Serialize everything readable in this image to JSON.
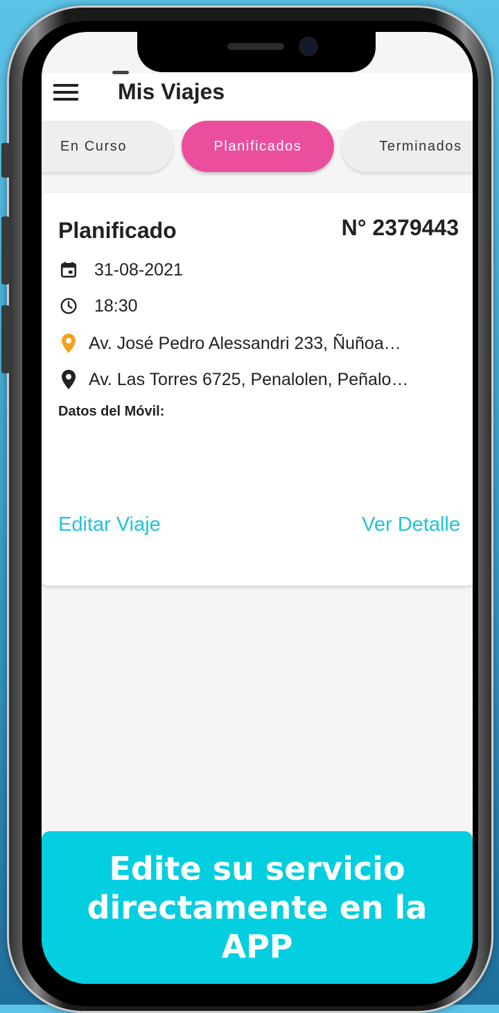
{
  "app": {
    "title": "Mis Viajes"
  },
  "tabs": [
    {
      "label": "En Curso",
      "active": false
    },
    {
      "label": "Planificados",
      "active": true
    },
    {
      "label": "Terminados",
      "active": false
    }
  ],
  "trip_card": {
    "status": "Planificado",
    "number": "N° 2379443",
    "date": "31-08-2021",
    "time": "18:30",
    "origin": "Av. José Pedro Alessandri 233, Ñuñoa…",
    "destination": "Av. Las Torres 6725, Penalolen, Peñalo…",
    "vehicle_label": "Datos del Móvil:",
    "edit_label": "Editar Viaje",
    "detail_label": "Ver Detalle"
  },
  "banner": {
    "text": "Edite su servicio directamente en la APP"
  },
  "colors": {
    "active_tab": "#ec4e9e",
    "link": "#1fc4d8",
    "banner": "#03cfe0",
    "origin_pin": "#f5a21b",
    "destination_pin": "#222222"
  },
  "icons": {
    "menu": "menu-icon",
    "date": "calendar-icon",
    "time": "clock-icon",
    "origin": "location-pin-icon",
    "destination": "location-pin-icon"
  }
}
